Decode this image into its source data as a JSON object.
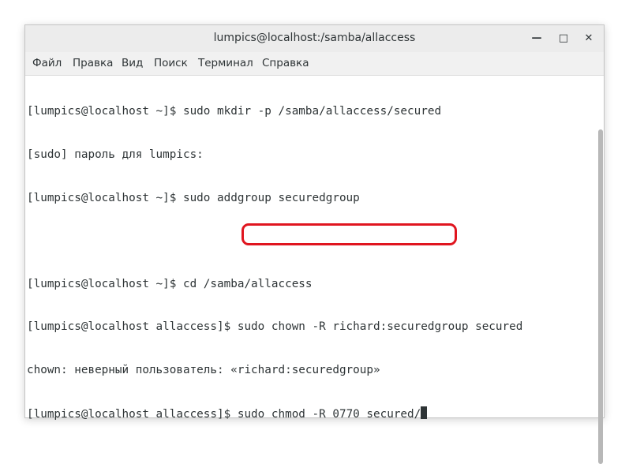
{
  "window": {
    "title": "lumpics@localhost:/samba/allaccess",
    "buttons": {
      "minimize": "—",
      "maximize": "□",
      "close": "✕"
    }
  },
  "menu": [
    "Файл",
    "Правка",
    "Вид",
    "Поиск",
    "Терминал",
    "Справка"
  ],
  "terminal": {
    "lines": [
      "[lumpics@localhost ~]$ sudo mkdir -p /samba/allaccess/secured",
      "[sudo] пароль для lumpics:",
      "[lumpics@localhost ~]$ sudo addgroup securedgroup",
      "",
      "[lumpics@localhost ~]$ cd /samba/allaccess",
      "[lumpics@localhost allaccess]$ sudo chown -R richard:securedgroup secured",
      "chown: неверный пользователь: «richard:securedgroup»"
    ],
    "prompt": "[lumpics@localhost allaccess]$ ",
    "current_command": "sudo chmod -R 0770 secured/"
  },
  "colors": {
    "highlight": "#e0151f",
    "text": "#2e3436"
  }
}
